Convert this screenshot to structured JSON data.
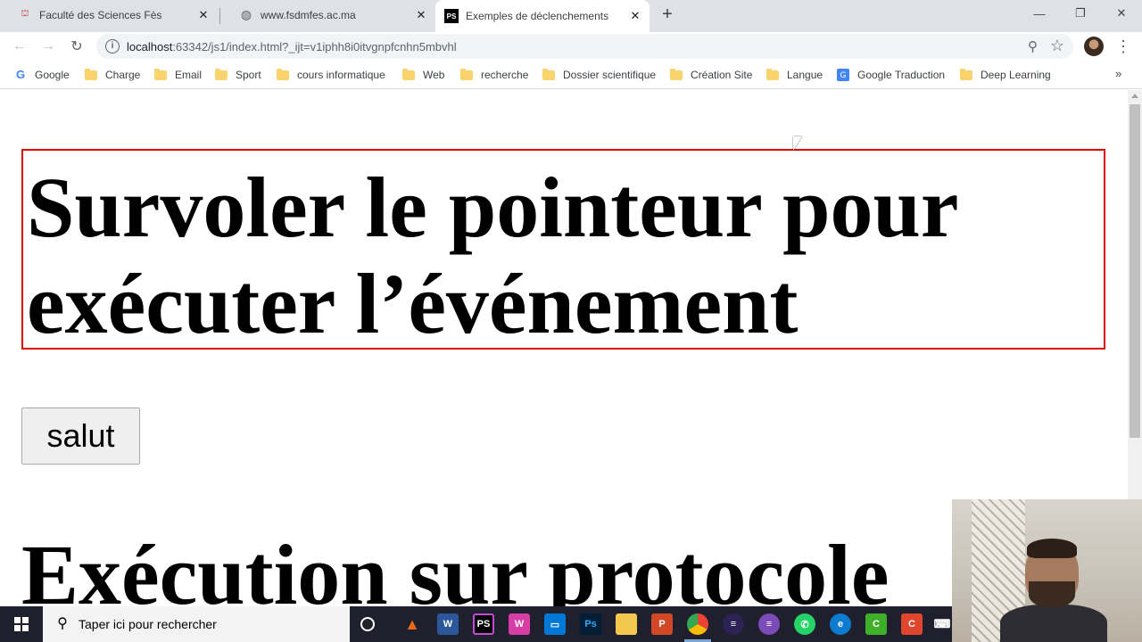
{
  "tabs": [
    {
      "title": "Faculté des Sciences Fès",
      "favicon": "university-icon"
    },
    {
      "title": "www.fsdmfes.ac.ma",
      "favicon": "globe-icon"
    },
    {
      "title": "Exemples de déclenchements",
      "favicon": "phpstorm-icon",
      "active": true
    }
  ],
  "address_bar": {
    "host": "localhost",
    "path": ":63342/js1/index.html?_ijt=v1iphh8i0itvgnpfcnhn5mbvhl"
  },
  "bookmarks": [
    {
      "label": "Google",
      "icon": "google-icon"
    },
    {
      "label": "Charge",
      "icon": "folder-icon"
    },
    {
      "label": "Email",
      "icon": "folder-icon"
    },
    {
      "label": "Sport",
      "icon": "folder-icon"
    },
    {
      "label": "cours informatique",
      "icon": "folder-icon"
    },
    {
      "label": "Web",
      "icon": "folder-icon"
    },
    {
      "label": "recherche",
      "icon": "folder-icon"
    },
    {
      "label": "Dossier scientifique",
      "icon": "folder-icon"
    },
    {
      "label": "Création Site",
      "icon": "folder-icon"
    },
    {
      "label": "Langue",
      "icon": "folder-icon"
    },
    {
      "label": "Google Traduction",
      "icon": "google-translate-icon"
    },
    {
      "label": "Deep Learning",
      "icon": "folder-icon"
    }
  ],
  "page": {
    "hover_text": "Survoler le pointeur pour exécuter l’événement",
    "button_label": "salut",
    "heading2": "Exécution sur protocole",
    "hover_border_color": "#e00000"
  },
  "taskbar": {
    "search_placeholder": "Taper ici pour rechercher",
    "apps": [
      "cortana-icon",
      "matlab-icon",
      "word-icon",
      "phpstorm-icon",
      "webstorm-icon",
      "window-icon",
      "photoshop-icon",
      "file-explorer-icon",
      "powerpoint-icon",
      "chrome-icon",
      "eclipse-icon",
      "eclipse-purple-icon",
      "whatsapp-icon",
      "edge-icon",
      "camtasia-green-icon",
      "camtasia-red-icon",
      "keyboard-icon"
    ]
  }
}
